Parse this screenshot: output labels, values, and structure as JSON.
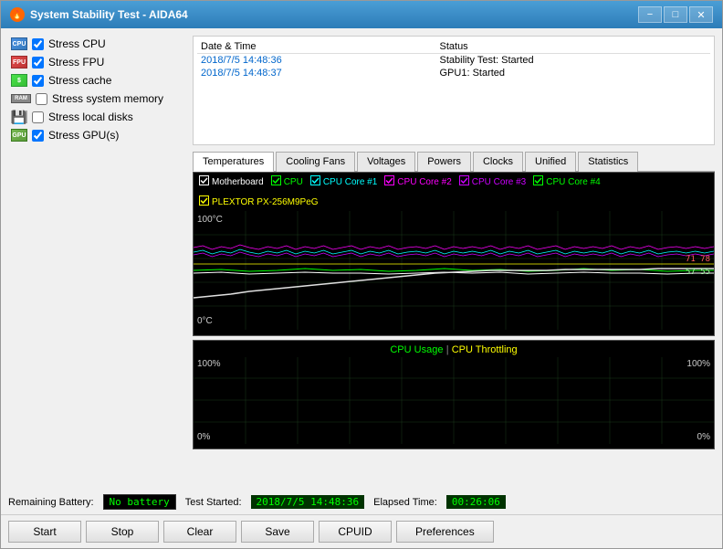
{
  "window": {
    "title": "System Stability Test - AIDA64",
    "icon": "🔥"
  },
  "title_buttons": {
    "minimize": "−",
    "maximize": "□",
    "close": "✕"
  },
  "checkboxes": [
    {
      "id": "cpu",
      "label": "Stress CPU",
      "checked": true,
      "icon": "cpu"
    },
    {
      "id": "fpu",
      "label": "Stress FPU",
      "checked": true,
      "icon": "fpu"
    },
    {
      "id": "cache",
      "label": "Stress cache",
      "checked": true,
      "icon": "cache"
    },
    {
      "id": "memory",
      "label": "Stress system memory",
      "checked": false,
      "icon": "mem"
    },
    {
      "id": "disk",
      "label": "Stress local disks",
      "checked": false,
      "icon": "disk"
    },
    {
      "id": "gpu",
      "label": "Stress GPU(s)",
      "checked": true,
      "icon": "gpu"
    }
  ],
  "log": {
    "columns": [
      "Date & Time",
      "Status"
    ],
    "rows": [
      {
        "date": "2018/7/5 14:48:36",
        "status": "Stability Test: Started"
      },
      {
        "date": "2018/7/5 14:48:37",
        "status": "GPU1: Started"
      }
    ]
  },
  "tabs": [
    {
      "id": "temperatures",
      "label": "Temperatures",
      "active": true
    },
    {
      "id": "cooling-fans",
      "label": "Cooling Fans",
      "active": false
    },
    {
      "id": "voltages",
      "label": "Voltages",
      "active": false
    },
    {
      "id": "powers",
      "label": "Powers",
      "active": false
    },
    {
      "id": "clocks",
      "label": "Clocks",
      "active": false
    },
    {
      "id": "unified",
      "label": "Unified",
      "active": false
    },
    {
      "id": "statistics",
      "label": "Statistics",
      "active": false
    }
  ],
  "top_chart": {
    "legend": [
      {
        "label": "Motherboard",
        "color": "#ffffff"
      },
      {
        "label": "CPU",
        "color": "#00ff00"
      },
      {
        "label": "CPU Core #1",
        "color": "#00ffff"
      },
      {
        "label": "CPU Core #2",
        "color": "#ff00ff"
      },
      {
        "label": "CPU Core #3",
        "color": "#cc00ff"
      },
      {
        "label": "CPU Core #4",
        "color": "#00ff00"
      },
      {
        "label": "PLEXTOR PX-256M9PeG",
        "color": "#ffff00"
      }
    ],
    "y_top": "100°C",
    "y_bottom": "0°C",
    "values_right": "71 78\n57 55"
  },
  "bottom_chart": {
    "title_left": "CPU Usage",
    "title_sep": "|",
    "title_right": "CPU Throttling",
    "title_left_color": "#00ff00",
    "title_right_color": "#ffff00",
    "y_top_left": "100%",
    "y_bottom_left": "0%",
    "y_top_right": "100%",
    "y_bottom_right": "0%"
  },
  "status_bar": {
    "battery_label": "Remaining Battery:",
    "battery_value": "No battery",
    "test_started_label": "Test Started:",
    "test_started_value": "2018/7/5 14:48:36",
    "elapsed_label": "Elapsed Time:",
    "elapsed_value": "00:26:06"
  },
  "buttons": [
    {
      "id": "start",
      "label": "Start"
    },
    {
      "id": "stop",
      "label": "Stop"
    },
    {
      "id": "clear",
      "label": "Clear"
    },
    {
      "id": "save",
      "label": "Save"
    },
    {
      "id": "cpuid",
      "label": "CPUID"
    },
    {
      "id": "preferences",
      "label": "Preferences"
    }
  ]
}
